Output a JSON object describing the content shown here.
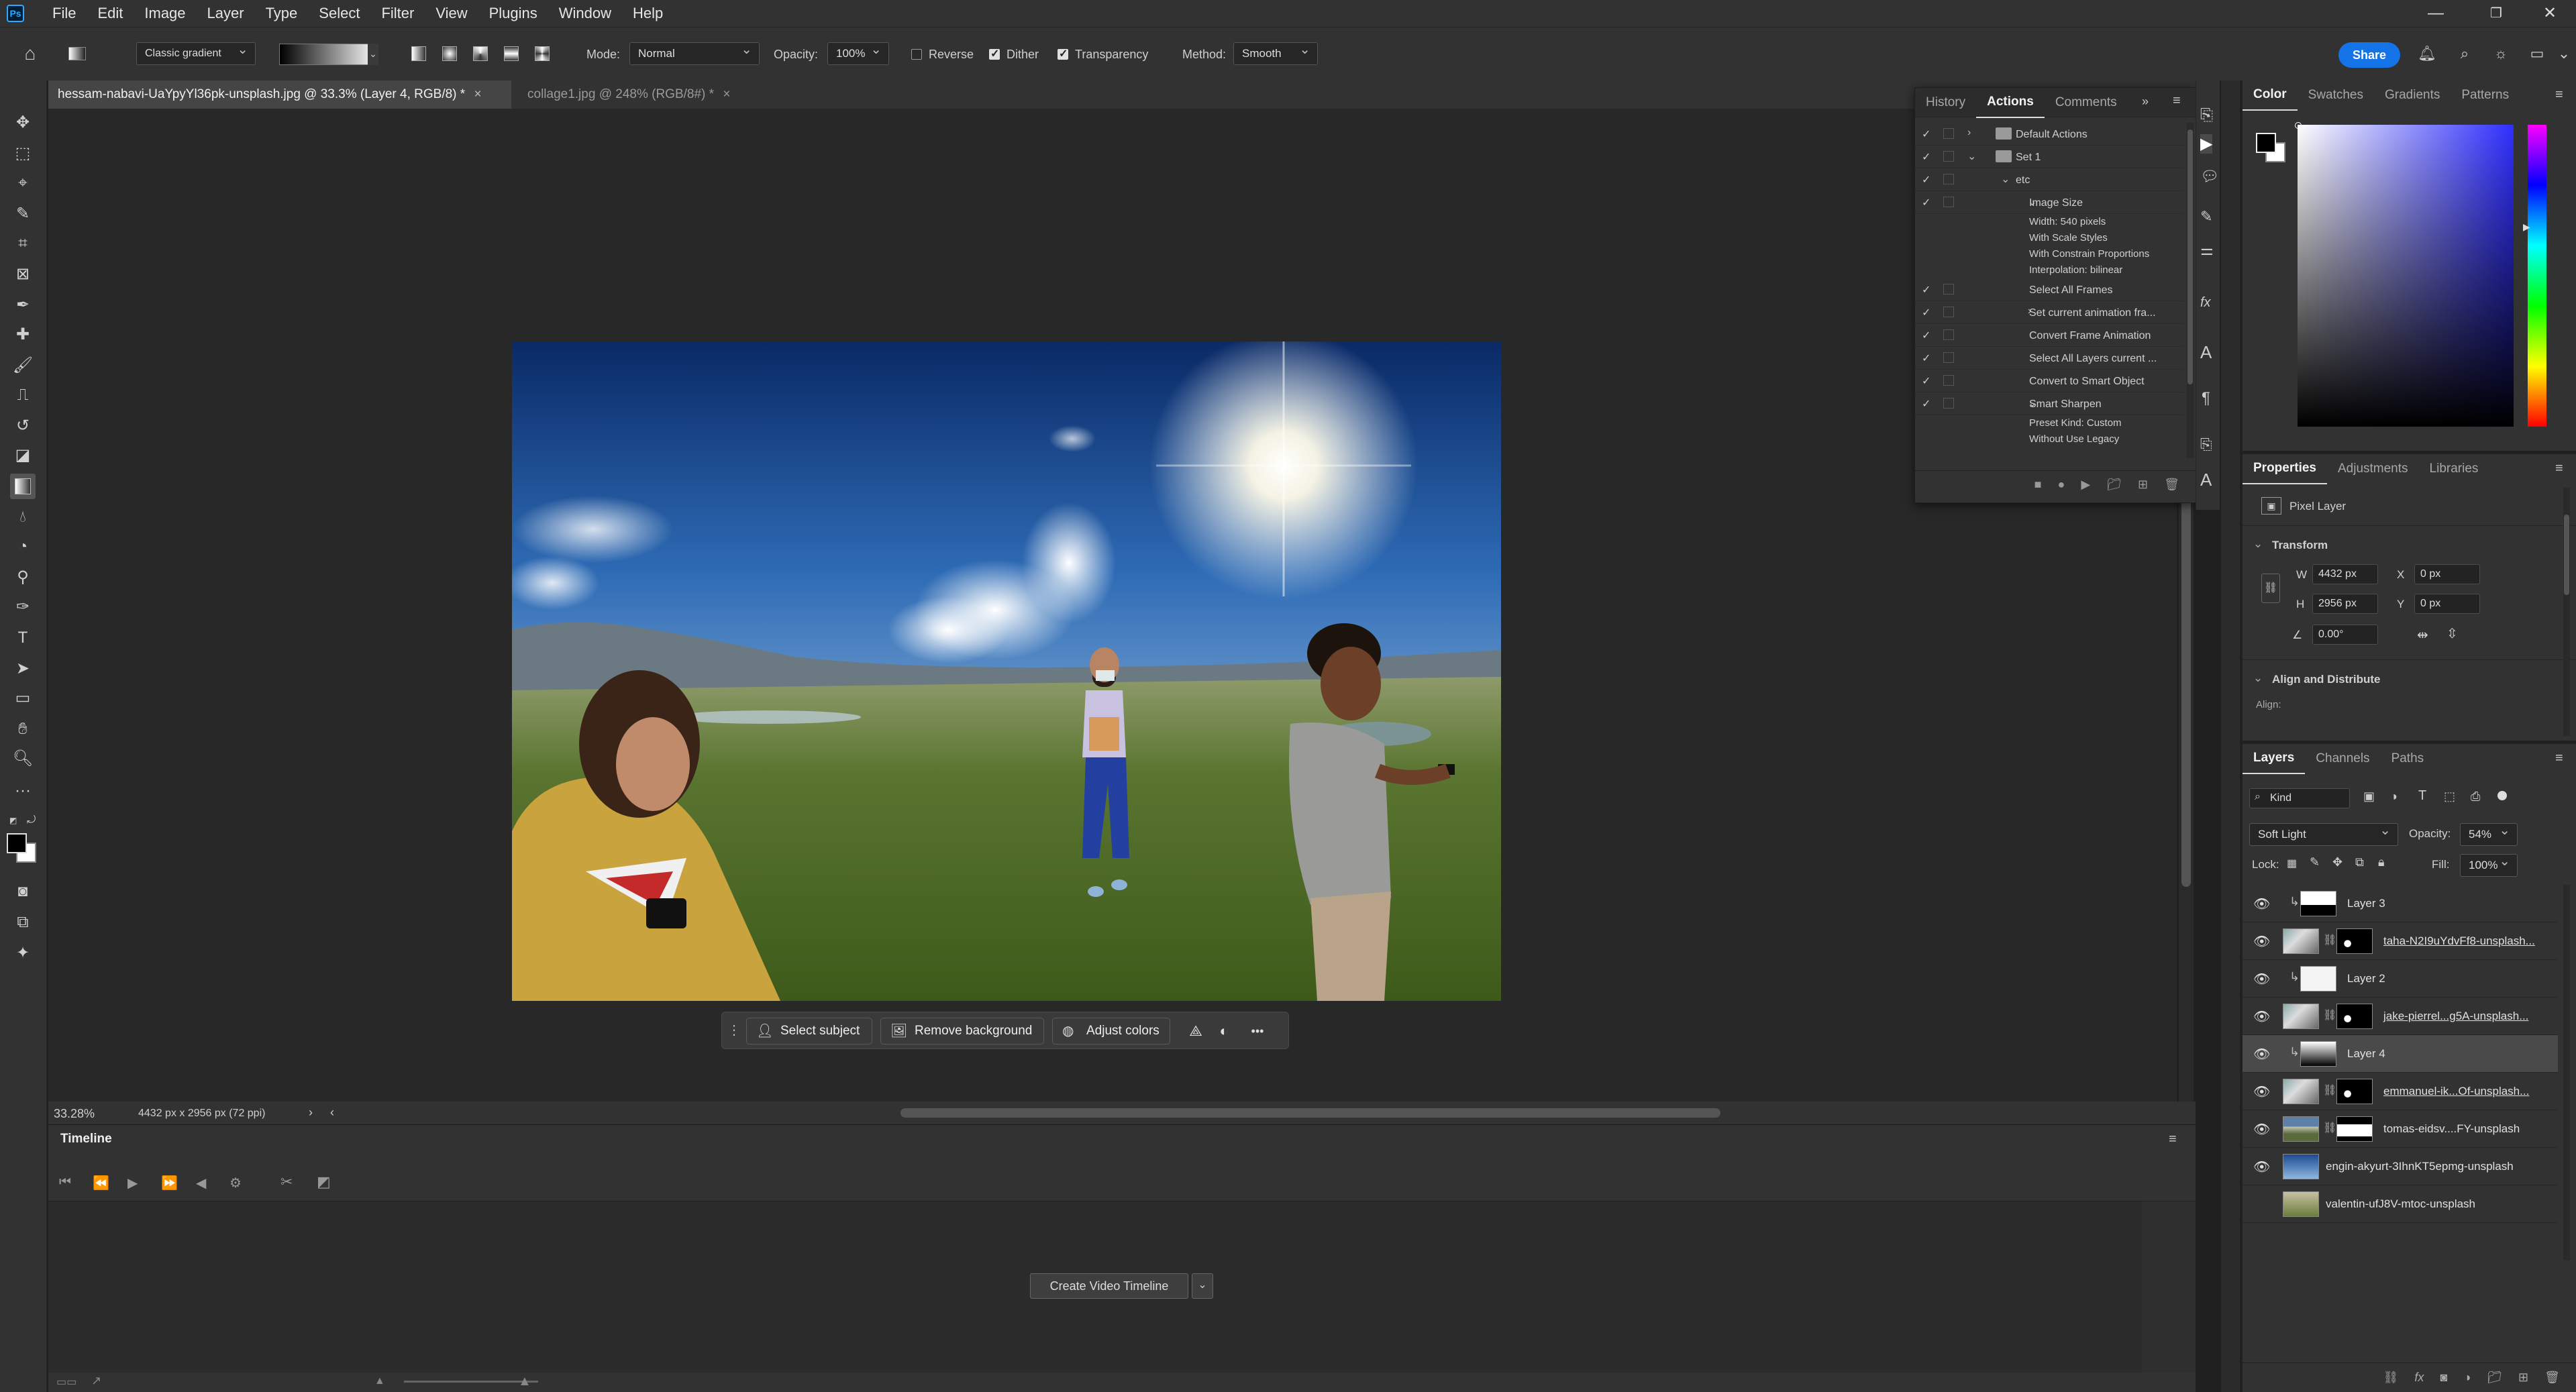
{
  "app": {
    "logo": "Ps",
    "menus": [
      "File",
      "Edit",
      "Image",
      "Layer",
      "Type",
      "Select",
      "Filter",
      "View",
      "Plugins",
      "Window",
      "Help"
    ],
    "window_controls": [
      "minimize-icon",
      "restore-icon",
      "close-icon"
    ]
  },
  "options": {
    "gradient_preset": "Classic gradient",
    "mode_label": "Mode:",
    "mode_value": "Normal",
    "opacity_label": "Opacity:",
    "opacity_value": "100%",
    "reverse_label": "Reverse",
    "reverse": false,
    "dither_label": "Dither",
    "dither": true,
    "transparency_label": "Transparency",
    "transparency": true,
    "method_label": "Method:",
    "method_value": "Smooth",
    "share_label": "Share"
  },
  "tabs": [
    {
      "label": "hessam-nabavi-UaYpyYl36pk-unsplash.jpg @ 33.3% (Layer 4, RGB/8) *",
      "close": "×"
    },
    {
      "label": "collage1.jpg @ 248% (RGB/8#) *",
      "close": "×"
    }
  ],
  "context_bar": {
    "select_subject": "Select subject",
    "remove_background": "Remove background",
    "adjust_colors": "Adjust colors",
    "more": "•••"
  },
  "status": {
    "zoom": "33.28%",
    "doc_info": "4432 px x 2956 px (72 ppi)",
    "next": "›",
    "prev": "‹"
  },
  "timeline": {
    "tab": "Timeline",
    "create_button": "Create Video Timeline"
  },
  "actions_panel": {
    "tabs": [
      "History",
      "Actions",
      "Comments"
    ],
    "items": [
      {
        "text": "Default Actions",
        "type": "set"
      },
      {
        "text": "Set 1",
        "type": "set"
      },
      {
        "text": "etc",
        "type": "action"
      },
      {
        "text": "Image Size",
        "type": "step"
      },
      {
        "text": "Width: 540 pixels",
        "type": "detail"
      },
      {
        "text": "With Scale Styles",
        "type": "detail"
      },
      {
        "text": "With Constrain Proportions",
        "type": "detail"
      },
      {
        "text": "Interpolation: bilinear",
        "type": "detail"
      },
      {
        "text": "Select All Frames",
        "type": "step"
      },
      {
        "text": "Set current animation fra...",
        "type": "step"
      },
      {
        "text": "Convert Frame Animation",
        "type": "step"
      },
      {
        "text": "Select All Layers current ...",
        "type": "step"
      },
      {
        "text": "Convert to Smart Object",
        "type": "step"
      },
      {
        "text": "Smart Sharpen",
        "type": "step"
      },
      {
        "text": "Preset Kind: Custom",
        "type": "detail"
      },
      {
        "text": "Without Use Legacy",
        "type": "detail"
      }
    ]
  },
  "color_panel": {
    "tabs": [
      "Color",
      "Swatches",
      "Gradients",
      "Patterns"
    ]
  },
  "properties": {
    "tabs": [
      "Properties",
      "Adjustments",
      "Libraries"
    ],
    "layer_type": "Pixel Layer",
    "transform_label": "Transform",
    "w_label": "W",
    "w": "4432 px",
    "x_label": "X",
    "x": "0 px",
    "h_label": "H",
    "h": "2956 px",
    "y_label": "Y",
    "y": "0 px",
    "angle": "0.00°",
    "align_label": "Align and Distribute",
    "align_sub": "Align:"
  },
  "layers_panel": {
    "tabs": [
      "Layers",
      "Channels",
      "Paths"
    ],
    "filter": "Kind",
    "blend_mode": "Soft Light",
    "opacity_label": "Opacity:",
    "opacity": "54%",
    "lock_label": "Lock:",
    "fill_label": "Fill:",
    "fill": "100%",
    "layers": [
      {
        "name": "Layer 3",
        "visible": true,
        "clip": true,
        "mask": false,
        "thumb": "white-top",
        "underline": false,
        "selected": false
      },
      {
        "name": "taha-N2I9uYdvFf8-unsplash...",
        "visible": true,
        "clip": false,
        "mask": true,
        "thumb": "photo",
        "underline": true,
        "selected": false
      },
      {
        "name": "Layer 2",
        "visible": true,
        "clip": true,
        "mask": false,
        "thumb": "white",
        "underline": false,
        "selected": false
      },
      {
        "name": "jake-pierrel...g5A-unsplash...",
        "visible": true,
        "clip": false,
        "mask": true,
        "thumb": "photo",
        "underline": true,
        "selected": false
      },
      {
        "name": "Layer 4",
        "visible": true,
        "clip": true,
        "mask": false,
        "thumb": "gradient",
        "underline": false,
        "selected": true
      },
      {
        "name": "emmanuel-ik...Of-unsplash...",
        "visible": true,
        "clip": false,
        "mask": true,
        "thumb": "photo",
        "underline": true,
        "selected": false
      },
      {
        "name": "tomas-eidsv....FY-unsplash",
        "visible": true,
        "clip": false,
        "mask": true,
        "thumb": "landscape",
        "underline": false,
        "selected": false
      },
      {
        "name": "engin-akyurt-3IhnKT5epmg-unsplash",
        "visible": true,
        "clip": false,
        "mask": false,
        "thumb": "sky",
        "underline": false,
        "selected": false
      },
      {
        "name": "valentin-ufJ8V-mtoc-unsplash",
        "visible": false,
        "clip": false,
        "mask": false,
        "thumb": "field",
        "underline": false,
        "selected": false
      }
    ]
  }
}
